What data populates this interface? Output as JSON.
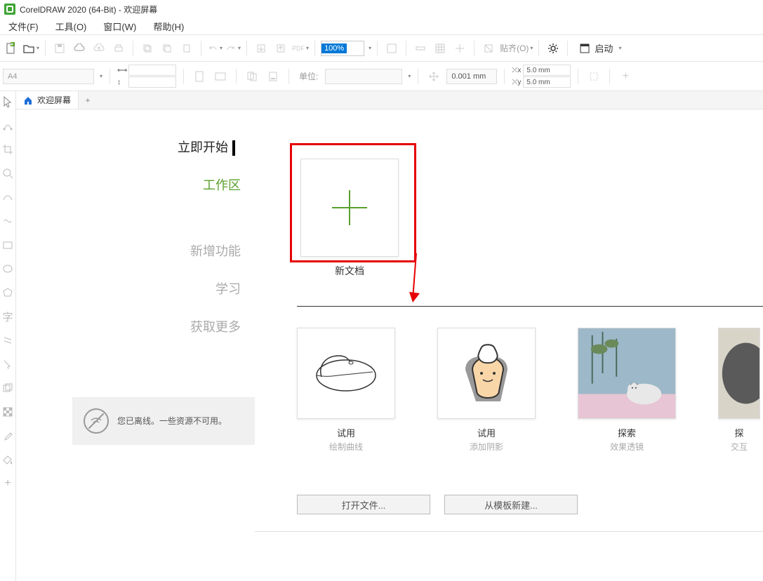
{
  "title": "CorelDRAW 2020 (64-Bit) - 欢迎屏幕",
  "menu": {
    "file": "文件(F)",
    "tools": "工具(O)",
    "window": "窗口(W)",
    "help": "帮助(H)"
  },
  "toolbar": {
    "zoom_value": "100%",
    "launch": "启动",
    "align_label": "贴齐(O)"
  },
  "propbar": {
    "page_size": "A4",
    "units_label": "单位:",
    "nudge": "0.001 mm",
    "dup_x": "5.0 mm",
    "dup_y": "5.0 mm"
  },
  "tab": {
    "welcome": "欢迎屏幕"
  },
  "nav": {
    "start": "立即开始",
    "workspace": "工作区",
    "whatsnew": "新增功能",
    "learn": "学习",
    "getmore": "获取更多"
  },
  "offline": "您已离线。一些资源不可用。",
  "new_doc": "新文档",
  "templates": [
    {
      "title": "试用",
      "sub": "绘制曲线"
    },
    {
      "title": "试用",
      "sub": "添加阴影"
    },
    {
      "title": "探索",
      "sub": "效果透镜"
    },
    {
      "title": "探",
      "sub": "交互"
    }
  ],
  "buttons": {
    "open": "打开文件...",
    "from_template": "从模板新建..."
  }
}
